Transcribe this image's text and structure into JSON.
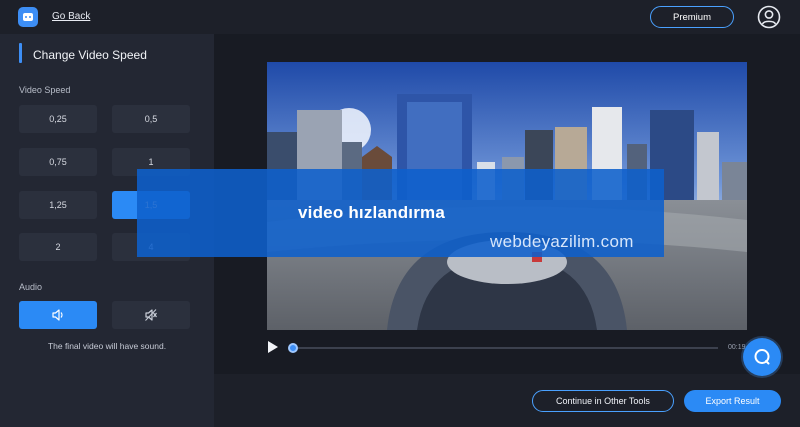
{
  "header": {
    "back_label": "Go Back",
    "premium_label": "Premium",
    "logo_icon": "app-logo-icon",
    "account_icon": "user-circle-icon"
  },
  "sidebar": {
    "title": "Change Video Speed",
    "speed_label": "Video Speed",
    "speed_options": [
      "0,25",
      "0,5",
      "0,75",
      "1",
      "1,25",
      "1,5",
      "2",
      "4"
    ],
    "selected_speed": "1,5",
    "audio_label": "Audio",
    "audio_on_icon": "speaker-on-icon",
    "audio_off_icon": "speaker-mute-icon",
    "audio_note": "The final video will have sound."
  },
  "player": {
    "play_icon": "play-icon",
    "progress": 0.0,
    "time_text": "00:19"
  },
  "footer": {
    "continue_label": "Continue in Other Tools",
    "export_label": "Export Result",
    "chat_icon": "chat-bubble-icon"
  },
  "overlay": {
    "title": "video hızlandırma",
    "site": "webdeyazilim.com"
  },
  "colors": {
    "accent": "#2b8af5",
    "background": "#1b1e27",
    "panel": "#232733"
  }
}
